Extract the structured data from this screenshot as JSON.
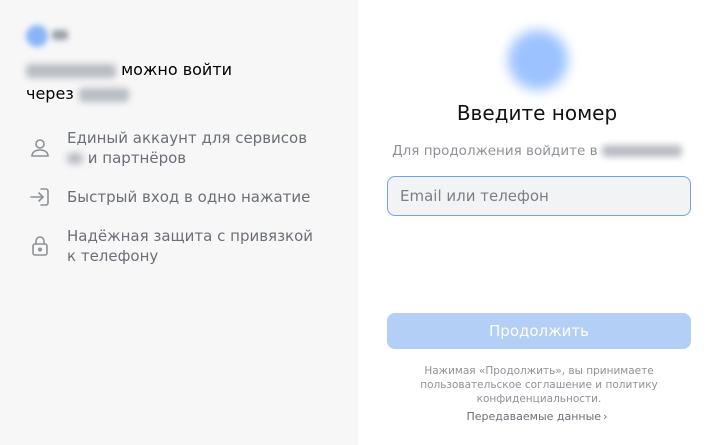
{
  "left": {
    "headline": {
      "part1": "можно войти",
      "part2": "через"
    },
    "features": [
      {
        "icon": "user-icon",
        "line1": "Единый аккаунт для сервисов",
        "line2": "и партнёров"
      },
      {
        "icon": "sign-in-icon",
        "line1": "Быстрый вход в одно нажатие"
      },
      {
        "icon": "lock-icon",
        "line1": "Надёжная защита с привязкой",
        "line2": "к телефону"
      }
    ]
  },
  "right": {
    "title": "Введите номер",
    "subtitle": "Для продолжения войдите в",
    "input_placeholder": "Email или телефон",
    "continue_label": "Продолжить",
    "legal": {
      "text1": "Нажимая «Продолжить», вы принимаете",
      "link1": "пользовательское соглашение",
      "conj": "и",
      "link2": "политику конфиденциальности",
      "end": "."
    },
    "transfer_label": "Передаваемые данные"
  },
  "colors": {
    "accent": "#6fa3f2",
    "button_disabled": "#b4cff5",
    "left_bg": "#f7f7f8"
  }
}
